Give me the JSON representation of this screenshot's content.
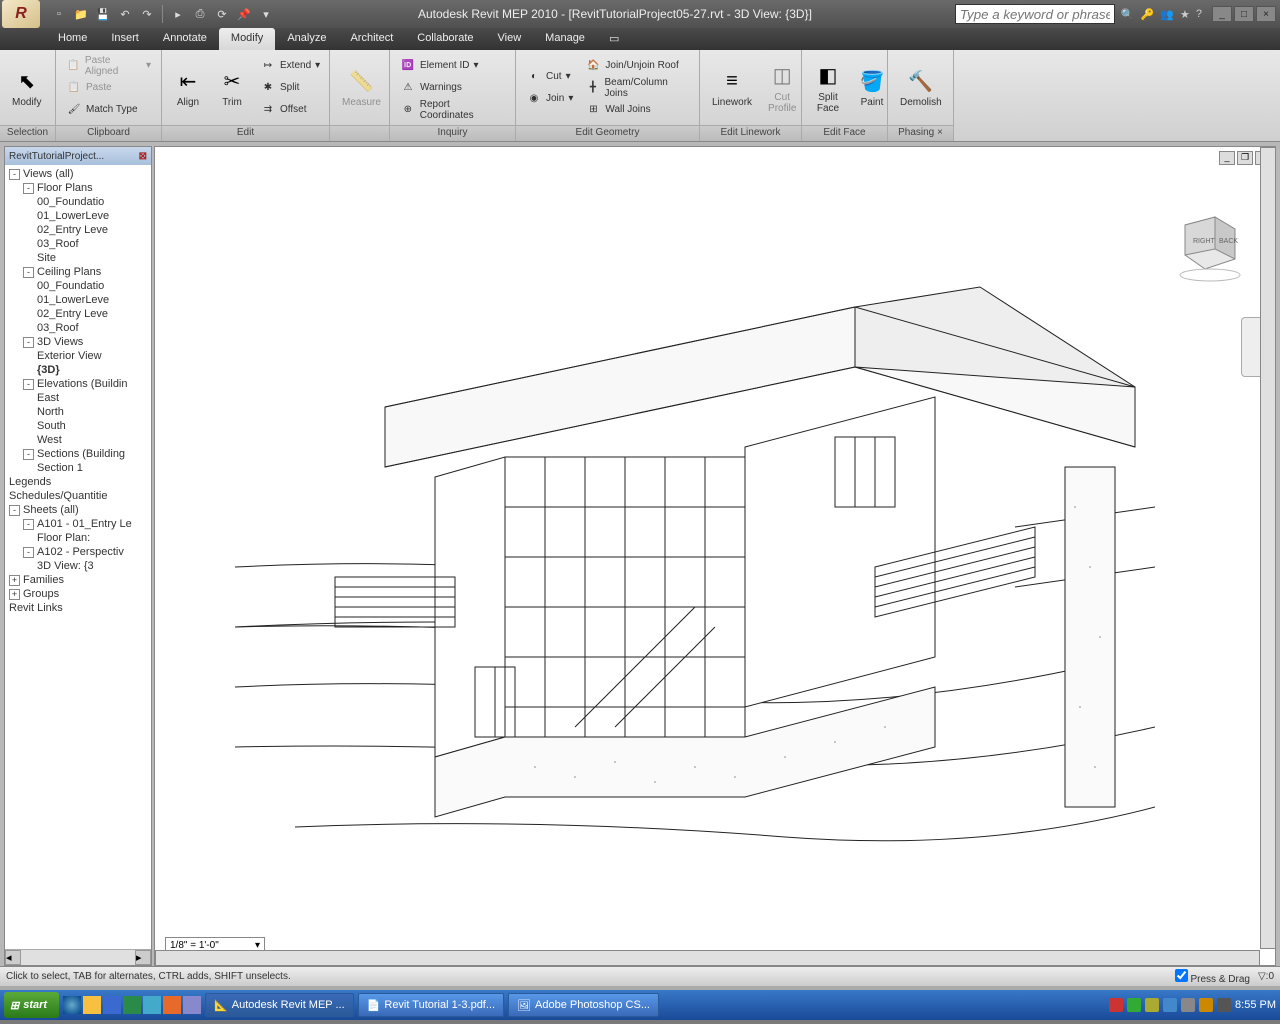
{
  "title": "Autodesk Revit MEP 2010 - [RevitTutorialProject05-27.rvt - 3D View: {3D}]",
  "search_placeholder": "Type a keyword or phrase",
  "menutabs": [
    "Home",
    "Insert",
    "Annotate",
    "Modify",
    "Analyze",
    "Architect",
    "Collaborate",
    "View",
    "Manage"
  ],
  "active_tab": "Modify",
  "ribbon": {
    "selection": {
      "label": "Selection",
      "modify": "Modify"
    },
    "clipboard": {
      "label": "Clipboard",
      "paste_aligned": "Paste Aligned",
      "paste": "Paste",
      "match_type": "Match Type"
    },
    "edit": {
      "label": "Edit",
      "align": "Align",
      "trim": "Trim",
      "extend": "Extend",
      "split": "Split",
      "offset": "Offset"
    },
    "measure_panel": {
      "label": "",
      "measure": "Measure"
    },
    "inquiry": {
      "label": "Inquiry",
      "element_id": "Element ID",
      "warnings": "Warnings",
      "report_coords": "Report Coordinates"
    },
    "edit_geometry": {
      "label": "Edit Geometry",
      "cut": "Cut",
      "join": "Join",
      "join_roof": "Join/Unjoin Roof",
      "beam_col": "Beam/Column Joins",
      "wall_joins": "Wall Joins"
    },
    "edit_linework": {
      "label": "Edit Linework",
      "linework": "Linework",
      "cut_profile": "Cut\nProfile"
    },
    "edit_face": {
      "label": "Edit Face",
      "split_face": "Split\nFace",
      "paint": "Paint"
    },
    "phasing": {
      "label": "Phasing",
      "demolish": "Demolish"
    }
  },
  "browser": {
    "title": "RevitTutorialProject...",
    "tree": [
      {
        "l": 0,
        "exp": "-",
        "t": "Views (all)"
      },
      {
        "l": 1,
        "exp": "-",
        "t": "Floor Plans"
      },
      {
        "l": 2,
        "t": "00_Foundatio"
      },
      {
        "l": 2,
        "t": "01_LowerLeve"
      },
      {
        "l": 2,
        "t": "02_Entry Leve"
      },
      {
        "l": 2,
        "t": "03_Roof"
      },
      {
        "l": 2,
        "t": "Site"
      },
      {
        "l": 1,
        "exp": "-",
        "t": "Ceiling Plans"
      },
      {
        "l": 2,
        "t": "00_Foundatio"
      },
      {
        "l": 2,
        "t": "01_LowerLeve"
      },
      {
        "l": 2,
        "t": "02_Entry Leve"
      },
      {
        "l": 2,
        "t": "03_Roof"
      },
      {
        "l": 1,
        "exp": "-",
        "t": "3D Views"
      },
      {
        "l": 2,
        "t": "Exterior View"
      },
      {
        "l": 2,
        "t": "{3D}",
        "bold": true
      },
      {
        "l": 1,
        "exp": "-",
        "t": "Elevations (Buildin"
      },
      {
        "l": 2,
        "t": "East"
      },
      {
        "l": 2,
        "t": "North"
      },
      {
        "l": 2,
        "t": "South"
      },
      {
        "l": 2,
        "t": "West"
      },
      {
        "l": 1,
        "exp": "-",
        "t": "Sections (Building"
      },
      {
        "l": 2,
        "t": "Section 1"
      },
      {
        "l": 0,
        "t": "Legends"
      },
      {
        "l": 0,
        "t": "Schedules/Quantitie"
      },
      {
        "l": 0,
        "exp": "-",
        "t": "Sheets (all)"
      },
      {
        "l": 1,
        "exp": "-",
        "t": "A101 - 01_Entry Le"
      },
      {
        "l": 2,
        "t": "Floor Plan:"
      },
      {
        "l": 1,
        "exp": "-",
        "t": "A102 - Perspectiv"
      },
      {
        "l": 2,
        "t": "3D View: {3"
      },
      {
        "l": 0,
        "exp": "+",
        "t": "Families"
      },
      {
        "l": 0,
        "exp": "+",
        "t": "Groups"
      },
      {
        "l": 0,
        "t": "Revit Links"
      }
    ]
  },
  "scale": "1/8\" = 1'-0\"",
  "viewcube": {
    "right": "RIGHT",
    "back": "BACK"
  },
  "status": {
    "hint": "Click to select, TAB for alternates, CTRL adds, SHIFT unselects.",
    "press_drag": "Press & Drag",
    "filter": "0"
  },
  "taskbar": {
    "start": "start",
    "tasks": [
      {
        "label": "Autodesk Revit MEP ...",
        "active": true
      },
      {
        "label": "Revit Tutorial 1-3.pdf..."
      },
      {
        "label": "Adobe Photoshop CS..."
      }
    ],
    "time": "8:55 PM"
  }
}
